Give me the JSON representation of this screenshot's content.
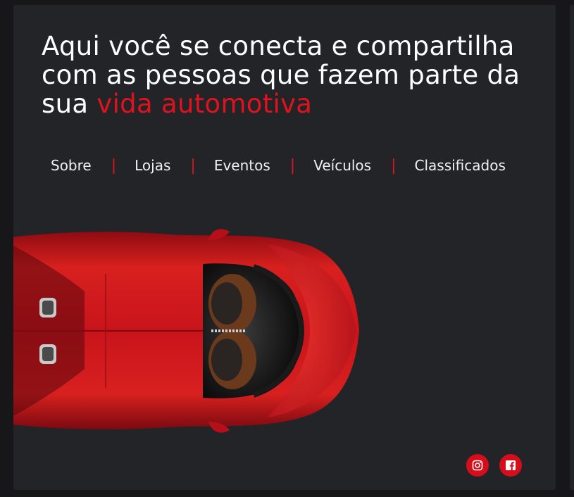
{
  "hero": {
    "headline_part1": "Aqui você se conecta e compartilha com as pessoas que fazem parte da sua ",
    "headline_highlight": "vida automotiva"
  },
  "nav": {
    "items": [
      "Sobre",
      "Lojas",
      "Eventos",
      "Veículos",
      "Classificados"
    ],
    "separator": "|"
  },
  "social": {
    "icons": [
      "instagram-icon",
      "facebook-icon"
    ]
  },
  "colors": {
    "accent": "#e0121e",
    "card_background": "#232428",
    "page_background": "#17171a",
    "car_red": "#c8141b"
  }
}
